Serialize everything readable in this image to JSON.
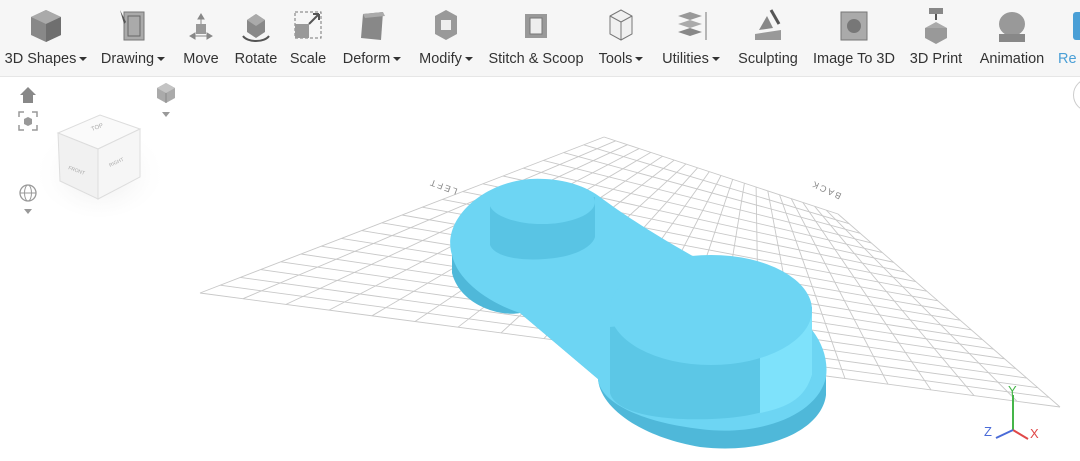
{
  "toolbar": {
    "items": [
      {
        "label": "3D Shapes",
        "dropdown": true,
        "icon": "cube-icon"
      },
      {
        "label": "Drawing",
        "dropdown": true,
        "icon": "drawing-icon"
      },
      {
        "label": "Move",
        "dropdown": false,
        "icon": "move-icon"
      },
      {
        "label": "Rotate",
        "dropdown": false,
        "icon": "rotate-icon"
      },
      {
        "label": "Scale",
        "dropdown": false,
        "icon": "scale-icon"
      },
      {
        "label": "Deform",
        "dropdown": true,
        "icon": "deform-icon"
      },
      {
        "label": "Modify",
        "dropdown": true,
        "icon": "modify-icon"
      },
      {
        "label": "Stitch & Scoop",
        "dropdown": false,
        "icon": "stitch-scoop-icon"
      },
      {
        "label": "Tools",
        "dropdown": true,
        "icon": "tools-icon"
      },
      {
        "label": "Utilities",
        "dropdown": true,
        "icon": "utilities-icon"
      },
      {
        "label": "Sculpting",
        "dropdown": false,
        "icon": "sculpting-icon"
      },
      {
        "label": "Image To 3D",
        "dropdown": false,
        "icon": "image-to-3d-icon"
      },
      {
        "label": "3D Print",
        "dropdown": false,
        "icon": "3d-print-icon"
      },
      {
        "label": "Animation",
        "dropdown": false,
        "icon": "animation-icon"
      },
      {
        "label": "Re",
        "dropdown": false,
        "icon": "render-icon"
      }
    ]
  },
  "viewport": {
    "grid_labels": {
      "left": "LEFT",
      "back": "BACK"
    },
    "view_cube": {
      "top": "TOP",
      "front": "FRONT",
      "right": "RIGHT"
    },
    "axes": {
      "x": "X",
      "y": "Y",
      "z": "Z"
    }
  },
  "colors": {
    "accent": "#4a9fd6",
    "model_top": "#6dd5f3",
    "model_side": "#4fb8d9",
    "axis_x": "#e04848",
    "axis_y": "#45b549",
    "axis_z": "#4a6bd8"
  }
}
